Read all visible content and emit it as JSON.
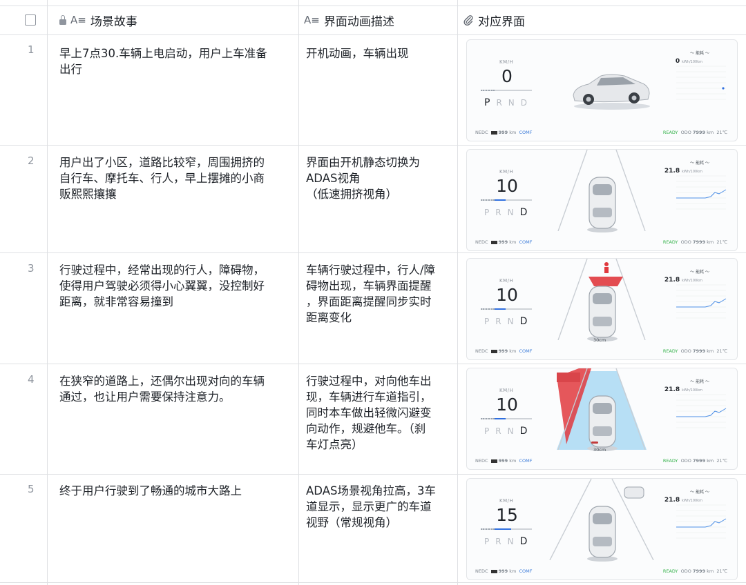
{
  "header": {
    "col1_title": "场景故事",
    "col2_title": "界面动画描述",
    "col3_title": "对应界面"
  },
  "rows": [
    {
      "num": "1",
      "story_lines": [
        "早上7点30.车辆上电启动，用户上车准备",
        "出行"
      ],
      "desc_lines": [
        "开机动画，车辆出现"
      ],
      "screen": {
        "kmh": "KM/H",
        "speed": "0",
        "speed_fill_pct": 0,
        "gear_p": "P",
        "gear_r": "R",
        "gear_n": "N",
        "gear_d": "D",
        "active_gear": "P",
        "eco": "～ 能耗 ～",
        "consumption": "0",
        "consumption_unit": "kWh/100km",
        "nedc": "NEDC",
        "range": "999",
        "range_unit": "km",
        "comf": "COMF",
        "ready": "READY",
        "odo_label": "ODO",
        "odo": "7999",
        "odo_unit": "km",
        "temp": "21℃",
        "distance": ""
      }
    },
    {
      "num": "2",
      "story_lines": [
        "用户出了小区，道路比较窄，周围拥挤的",
        "自行车、摩托车、行人，早上摆摊的小商",
        "贩熙熙攘攘"
      ],
      "desc_lines": [
        "界面由开机静态切换为",
        "ADAS视角",
        "（低速拥挤视角）"
      ],
      "screen": {
        "kmh": "KM/H",
        "speed": "10",
        "speed_fill_pct": 30,
        "gear_p": "P",
        "gear_r": "R",
        "gear_n": "N",
        "gear_d": "D",
        "active_gear": "D",
        "eco": "～ 能耗 ～",
        "consumption": "21.8",
        "consumption_unit": "kWh/100km",
        "nedc": "NEDC",
        "range": "999",
        "range_unit": "km",
        "comf": "COMF",
        "ready": "READY",
        "odo_label": "ODO",
        "odo": "7999",
        "odo_unit": "km",
        "temp": "21℃",
        "distance": ""
      }
    },
    {
      "num": "3",
      "story_lines": [
        "行驶过程中，经常出现的行人，障碍物，",
        "使得用户驾驶必须得小心翼翼，没控制好",
        "距离，就非常容易撞到"
      ],
      "desc_lines": [
        "车辆行驶过程中，行人/障",
        "碍物出现，车辆界面提醒",
        "，界面距离提醒同步实时",
        "距离变化"
      ],
      "screen": {
        "kmh": "KM/H",
        "speed": "10",
        "speed_fill_pct": 30,
        "gear_p": "P",
        "gear_r": "R",
        "gear_n": "N",
        "gear_d": "D",
        "active_gear": "D",
        "eco": "～ 能耗 ～",
        "consumption": "21.8",
        "consumption_unit": "kWh/100km",
        "nedc": "NEDC",
        "range": "999",
        "range_unit": "km",
        "comf": "COMF",
        "ready": "READY",
        "odo_label": "ODO",
        "odo": "7999",
        "odo_unit": "km",
        "temp": "21℃",
        "distance": "30cm"
      }
    },
    {
      "num": "4",
      "story_lines": [
        "在狭窄的道路上，还偶尔出现对向的车辆",
        "通过，也让用户需要保持注意力。"
      ],
      "desc_lines": [
        "行驶过程中，对向他车出",
        "现，车辆进行车道指引，",
        "同时本车做出轻微闪避变",
        "向动作，规避他车。（刹",
        "车灯点亮）"
      ],
      "screen": {
        "kmh": "KM/H",
        "speed": "10",
        "speed_fill_pct": 30,
        "gear_p": "P",
        "gear_r": "R",
        "gear_n": "N",
        "gear_d": "D",
        "active_gear": "D",
        "eco": "～ 能耗 ～",
        "consumption": "21.8",
        "consumption_unit": "kWh/100km",
        "nedc": "NEDC",
        "range": "999",
        "range_unit": "km",
        "comf": "COMF",
        "ready": "READY",
        "odo_label": "ODO",
        "odo": "7999",
        "odo_unit": "km",
        "temp": "21℃",
        "distance": "30cm"
      }
    },
    {
      "num": "5",
      "story_lines": [
        "终于用户行驶到了畅通的城市大路上"
      ],
      "desc_lines": [
        "ADAS场景视角拉高，3车",
        "道显示，显示更广的车道",
        "视野（常规视角）"
      ],
      "screen": {
        "kmh": "KM/H",
        "speed": "15",
        "speed_fill_pct": 45,
        "gear_p": "P",
        "gear_r": "R",
        "gear_n": "N",
        "gear_d": "D",
        "active_gear": "D",
        "eco": "～ 能耗 ～",
        "consumption": "21.8",
        "consumption_unit": "kWh/100km",
        "nedc": "NEDC",
        "range": "999",
        "range_unit": "km",
        "comf": "COMF",
        "ready": "READY",
        "odo_label": "ODO",
        "odo": "7999",
        "odo_unit": "km",
        "temp": "21℃",
        "distance": ""
      }
    }
  ],
  "icons": {
    "checkbox": "checkbox-icon",
    "lock": "lock-icon",
    "text_field": "text-field-icon",
    "attachment": "attachment-icon"
  },
  "colors": {
    "accent": "#2f6fe0",
    "ready": "#35b24a",
    "warning": "#e0393e",
    "lane": "#7fc6ef"
  }
}
